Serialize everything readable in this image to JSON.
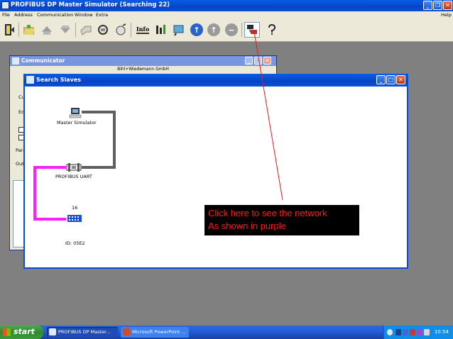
{
  "app": {
    "title": "PROFIBUS DP Master Simulator (Searching 22)",
    "menu": [
      "File",
      "Address",
      "Communication",
      "Window",
      "Extra"
    ],
    "help": "Help",
    "toolbar": {
      "info_label": "Info"
    }
  },
  "communicator": {
    "title": "Communicator",
    "subtitle": "Bihl+Wiedemann GmbH",
    "labels": [
      "Cu",
      "Ed",
      "Para",
      "Outp"
    ]
  },
  "search_slaves": {
    "title": "Search Slaves",
    "nodes": {
      "master": "Master Simulator",
      "uart": "PROFIBUS UART",
      "slave_address": "16",
      "slave_id": "ID: 05E2"
    },
    "colors": {
      "highlight_path": "#ff1cff",
      "cable": "#5f5f5f"
    }
  },
  "callout": {
    "line1": "Click here to see the network",
    "line2": "As shown in purple",
    "text_color": "#ff1a1a"
  },
  "taskbar": {
    "start_label": "start",
    "tasks": [
      "PROFIBUS DP Master...",
      "Microsoft PowerPoint ..."
    ],
    "clock": "10:54"
  }
}
